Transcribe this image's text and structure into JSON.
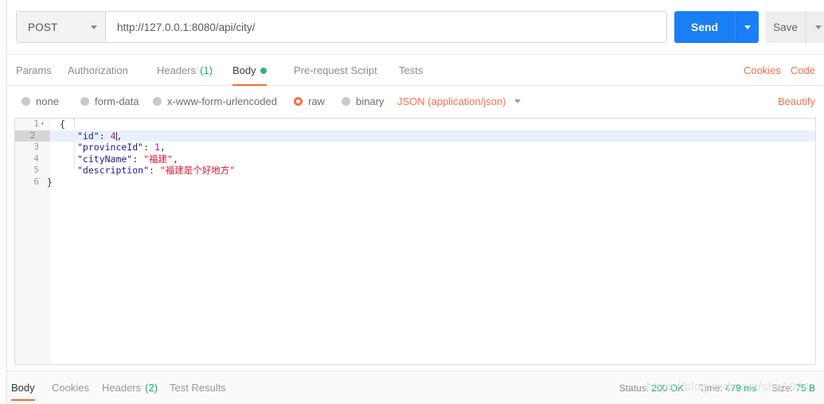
{
  "request": {
    "method": "POST",
    "url": "http://127.0.0.1:8080/api/city/",
    "send_label": "Send",
    "save_label": "Save"
  },
  "request_tabs": [
    {
      "label": "Params",
      "count": "",
      "active": false,
      "dot": false
    },
    {
      "label": "Authorization",
      "count": "",
      "active": false,
      "dot": false
    },
    {
      "label": "Headers",
      "count": "(1)",
      "active": false,
      "dot": false
    },
    {
      "label": "Body",
      "count": "",
      "active": true,
      "dot": true
    },
    {
      "label": "Pre-request Script",
      "count": "",
      "active": false,
      "dot": false
    },
    {
      "label": "Tests",
      "count": "",
      "active": false,
      "dot": false
    }
  ],
  "corner_links": {
    "cookies": "Cookies",
    "code": "Code"
  },
  "body_types": [
    {
      "label": "none",
      "selected": false
    },
    {
      "label": "form-data",
      "selected": false
    },
    {
      "label": "x-www-form-urlencoded",
      "selected": false
    },
    {
      "label": "raw",
      "selected": true
    },
    {
      "label": "binary",
      "selected": false
    }
  ],
  "content_type": "JSON (application/json)",
  "beautify_label": "Beautify",
  "editor": {
    "active_line": 2,
    "lines": [
      {
        "num": "1",
        "fold": "▾"
      },
      {
        "num": "2",
        "fold": ""
      },
      {
        "num": "3",
        "fold": ""
      },
      {
        "num": "4",
        "fold": ""
      },
      {
        "num": "5",
        "fold": ""
      },
      {
        "num": "6",
        "fold": ""
      }
    ],
    "code": {
      "l1_brace": "{",
      "l2_key": "\"id\"",
      "l2_colon": ": ",
      "l2_val": "4",
      "l2_comma": ",",
      "l3_key": "\"provinceId\"",
      "l3_colon": ": ",
      "l3_val": "1",
      "l3_comma": ",",
      "l4_key": "\"cityName\"",
      "l4_colon": ": ",
      "l4_val": "\"福建\"",
      "l4_comma": ",",
      "l5_key": "\"description\"",
      "l5_colon": ": ",
      "l5_val": "\"福建是个好地方\"",
      "l6_brace": "}"
    }
  },
  "response_tabs": [
    {
      "label": "Body",
      "count": "",
      "active": true
    },
    {
      "label": "Cookies",
      "count": "",
      "active": false
    },
    {
      "label": "Headers",
      "count": "(2)",
      "active": false
    },
    {
      "label": "Test Results",
      "count": "",
      "active": false
    }
  ],
  "response_meta": {
    "status_label": "Status:",
    "status_value": "200 OK",
    "time_label": "Time:",
    "time_value": "479 ms",
    "size_label": "Size:",
    "size_value": "75 B"
  },
  "watermark": "https://blog.csdn.net/sha1024",
  "colors": {
    "accent_orange": "#f26b3a",
    "send_blue": "#1a7ef4",
    "status_green": "#19a974",
    "json_key": "#1a1a8c",
    "json_string": "#d01a3a",
    "json_number": "#a020a0"
  }
}
